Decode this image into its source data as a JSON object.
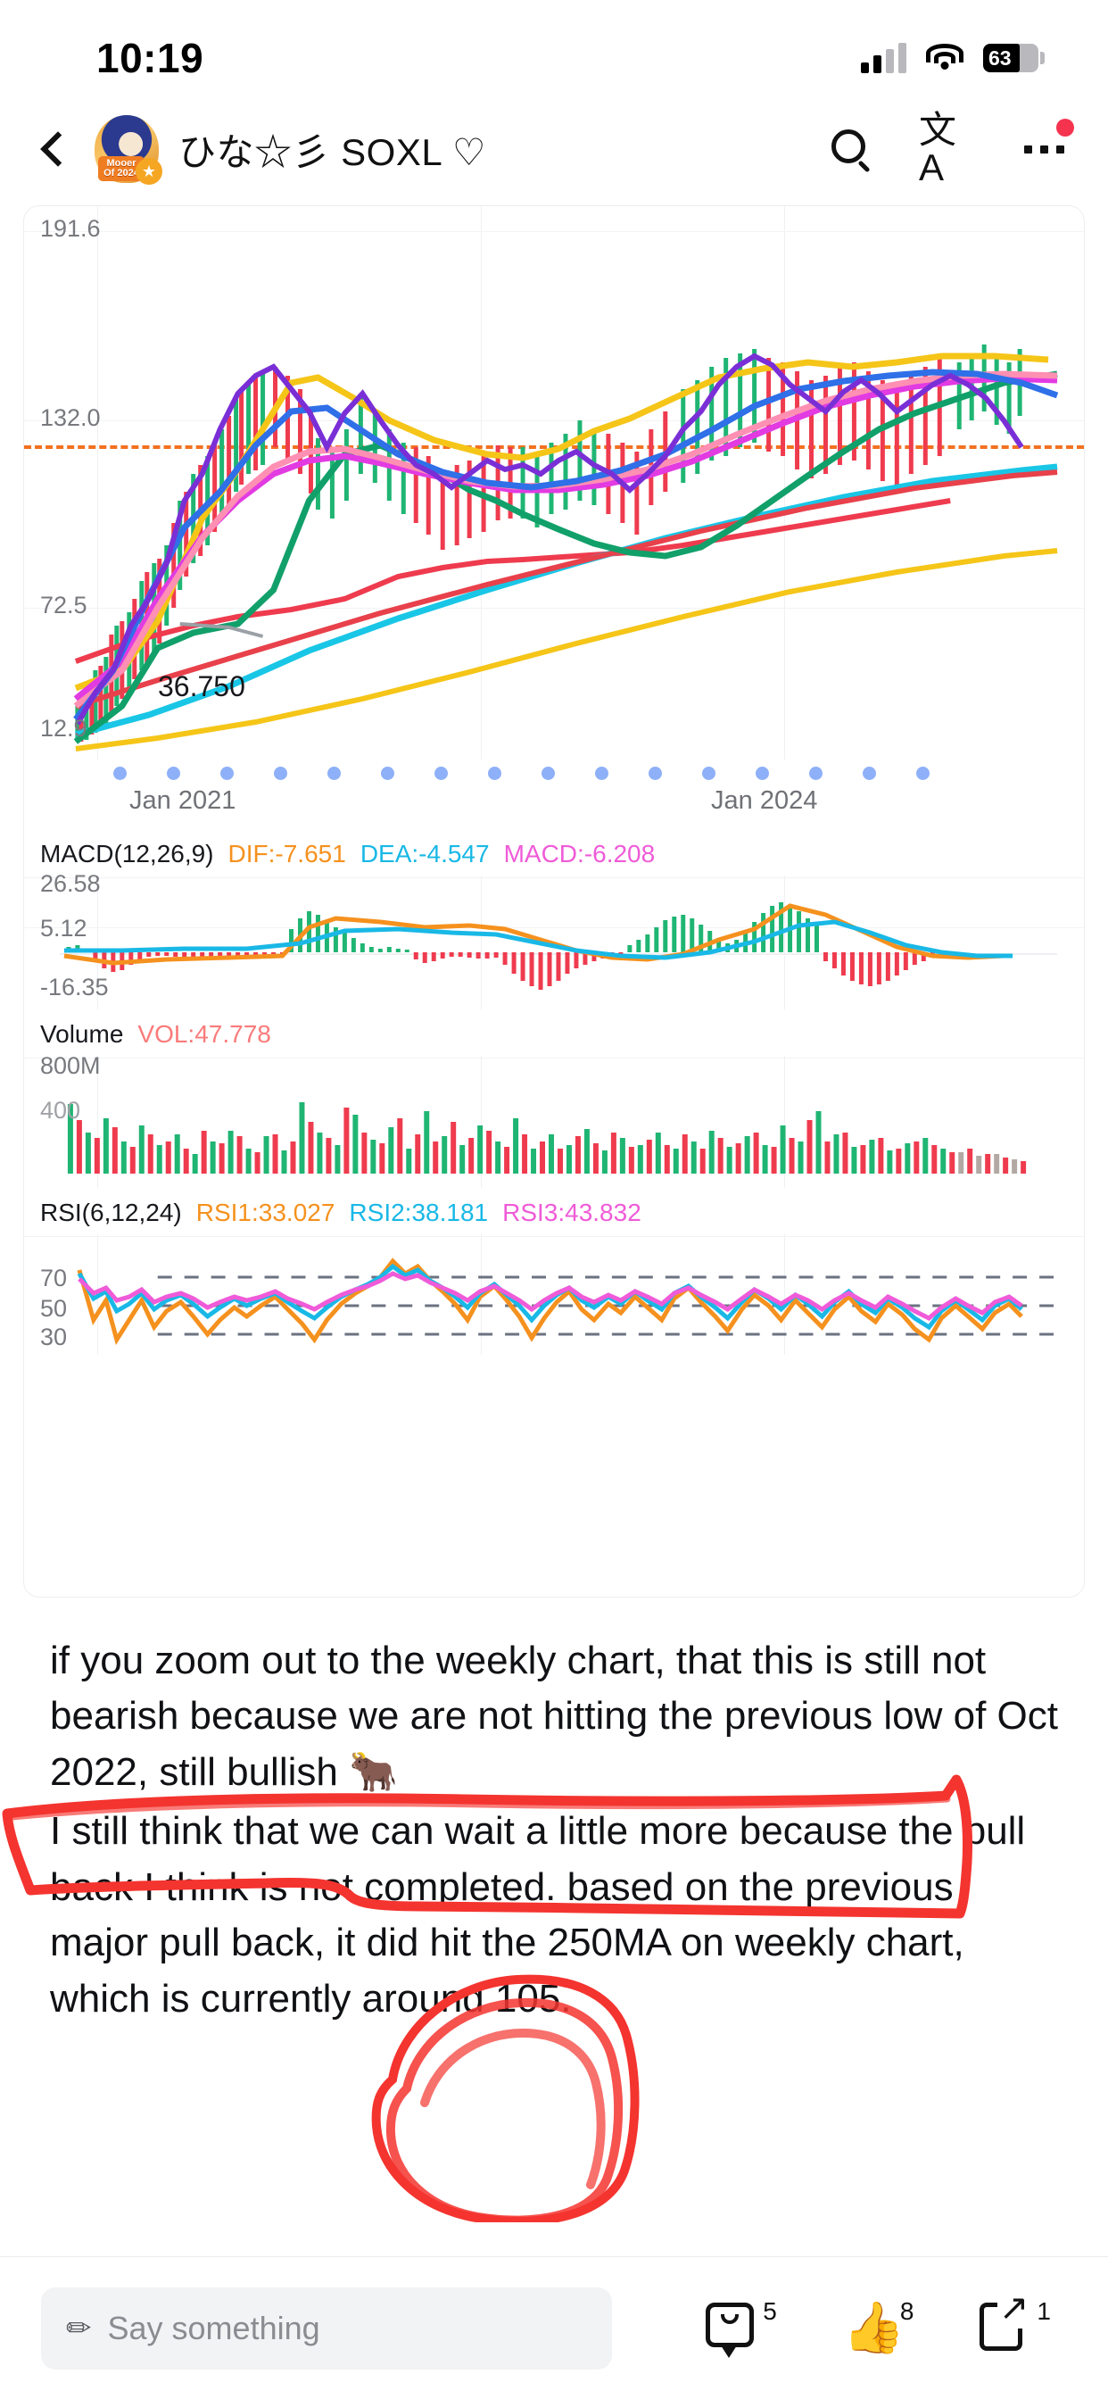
{
  "status_bar": {
    "time": "10:19",
    "battery_percent": "63",
    "cellular_icon": "cellular-bars-icon",
    "wifi_icon": "wifi-icon",
    "battery_icon": "battery-icon"
  },
  "nav_bar": {
    "back_icon": "back-chevron-icon",
    "avatar": {
      "badge_line1": "Mooer",
      "badge_line2": "Of 2024",
      "star": "★"
    },
    "username": "ひな☆彡 SOXL ♡",
    "search_icon": "search-icon",
    "translate_icon": "文A",
    "more_icon": "more-options-icon",
    "has_notification_dot": true
  },
  "chart_data": {
    "type": "line",
    "title": "SOXL weekly candlestick chart with indicators",
    "price_pane": {
      "y_ticks": [
        "191.6",
        "132.0",
        "72.5",
        "12.9"
      ],
      "ylim": [
        12.9,
        191.6
      ],
      "price_label": "36.750",
      "alert_line_value": "132.0",
      "alert_line_color": "#f27121",
      "x_ticks": [
        "Jan 2021",
        "Jan 2024"
      ],
      "series": [
        {
          "name": "MA-yellow",
          "color": "#f5c518"
        },
        {
          "name": "MA-cyan",
          "color": "#19c6e6"
        },
        {
          "name": "MA-magenta",
          "color": "#e23be2"
        },
        {
          "name": "MA-blue",
          "color": "#2f6fe8"
        },
        {
          "name": "MA-green",
          "color": "#11a06a"
        },
        {
          "name": "MA-red",
          "color": "#e8414b"
        },
        {
          "name": "MA-pink",
          "color": "#ff8fb3"
        },
        {
          "name": "MA-purple",
          "color": "#7a2fd6"
        }
      ],
      "candle_up_color": "#1fb573",
      "candle_down_color": "#ef3b4e"
    },
    "macd_pane": {
      "label": "MACD(12,26,9)",
      "legend": [
        {
          "name": "DIF",
          "value": "-7.651",
          "color": "#f5911e"
        },
        {
          "name": "DEA",
          "value": "-4.547",
          "color": "#19b8e6"
        },
        {
          "name": "MACD",
          "value": "-6.208",
          "color": "#ef5bd8"
        }
      ],
      "y_ticks": [
        "26.58",
        "5.12",
        "-16.35"
      ],
      "ylim": [
        -16.35,
        26.58
      ]
    },
    "volume_pane": {
      "label": "Volume",
      "legend": [
        {
          "name": "VOL",
          "value": "47.778",
          "color": "#fa7b7b"
        }
      ],
      "y_ticks": [
        "800M",
        "400"
      ],
      "ylim": [
        0,
        800
      ]
    },
    "rsi_pane": {
      "label": "RSI(6,12,24)",
      "legend": [
        {
          "name": "RSI1",
          "value": "33.027",
          "color": "#f5911e"
        },
        {
          "name": "RSI2",
          "value": "38.181",
          "color": "#19b8e6"
        },
        {
          "name": "RSI3",
          "value": "43.832",
          "color": "#ef5bd8"
        }
      ],
      "y_ticks": [
        "70",
        "50",
        "30"
      ],
      "ylim": [
        20,
        85
      ],
      "guide_lines": [
        70,
        50,
        30
      ]
    }
  },
  "post": {
    "paragraph_1": "if you zoom out to the weekly chart, that this is still not bearish because we are not hitting the previous low of Oct 2022, still bullish 🐂",
    "paragraph_2": "I still think that we can wait a little more because the pull back I think is not completed. based on the previous major pull back, it did hit the 250MA on weekly chart, which is currently around 105.",
    "annotation_color": "#f4342f",
    "annotations": [
      "hand-drawn-red-rectangle",
      "hand-drawn-red-circle"
    ]
  },
  "bottom_bar": {
    "comment_placeholder": "Say something",
    "pencil_icon": "pencil-icon",
    "comment_icon": "comment-icon",
    "comment_count": "5",
    "like_icon": "thumbs-up-icon",
    "like_count": "8",
    "share_icon": "share-icon",
    "share_count": "1"
  }
}
